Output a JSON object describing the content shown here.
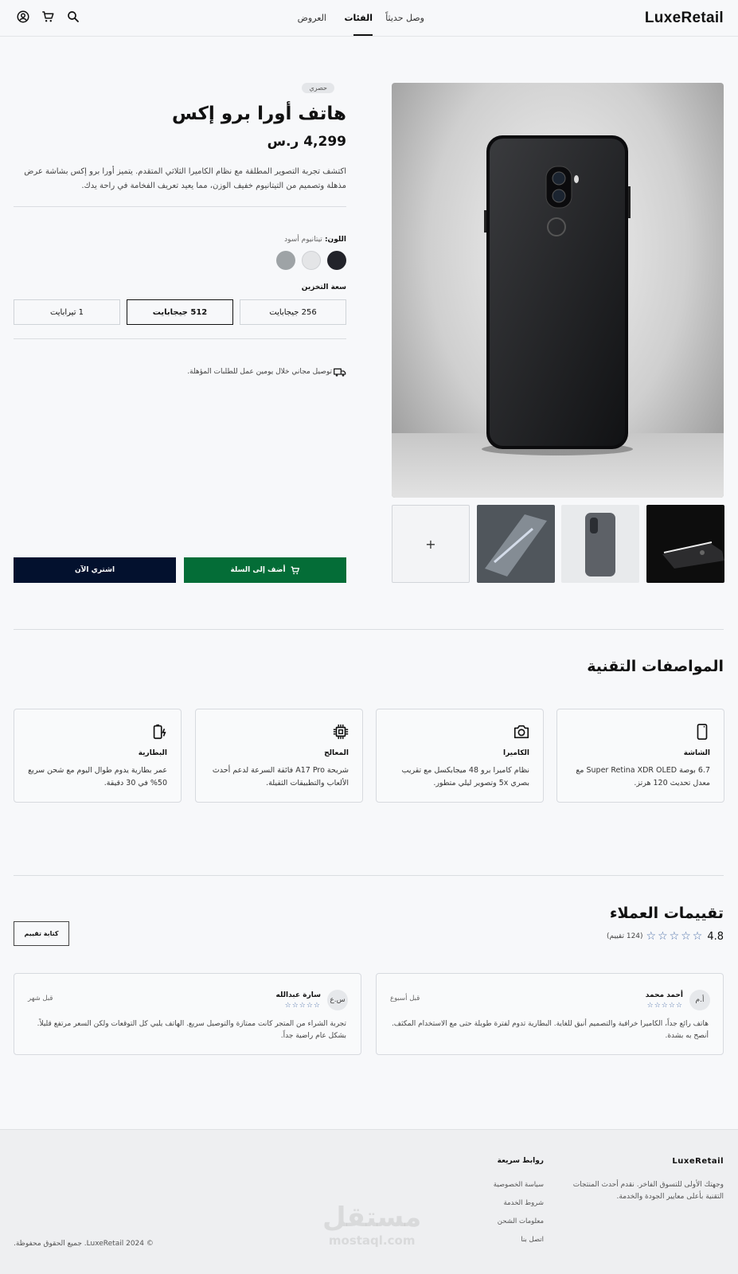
{
  "header": {
    "logo": "LuxeRetail",
    "nav": [
      {
        "label": "وصل حديثاً"
      },
      {
        "label": "الفئات"
      },
      {
        "label": "العروض"
      }
    ],
    "icons": [
      "search-icon",
      "cart-icon",
      "account-icon"
    ]
  },
  "product": {
    "badge": "حصري",
    "title": "هاتف أورا برو إكس",
    "price": "4,299 ر.س",
    "description": "اكتشف تجربة التصوير المطلقة مع نظام الكاميرا الثلاثي المتقدم. يتميز أورا برو إكس بشاشة عرض مذهلة وتصميم من التيتانيوم خفيف الوزن، مما يعيد تعريف الفخامة في راحة يدك.",
    "color_label": "اللون:",
    "color_value": "تيتانيوم أسود",
    "colors": [
      "#22232a",
      "#e4e5e7",
      "#9ea3a6"
    ],
    "storage_label": "سعة التخزين",
    "storage_options": [
      {
        "label": "256 جيجابايت",
        "selected": false
      },
      {
        "label": "512 جيجابايت",
        "selected": true
      },
      {
        "label": "1 تيرابايت",
        "selected": false
      }
    ],
    "shipping": "توصيل مجاني خلال يومين عمل للطلبات المؤهلة.",
    "add_to_cart": "أضف إلى السلة",
    "buy_now": "اشتري الآن",
    "add_thumb": "+",
    "colors_ui": {
      "cart_btn": "#046d37",
      "buy_btn": "#03112e"
    }
  },
  "specs": {
    "title": "المواصفات التقنية",
    "items": [
      {
        "icon": "phone-icon",
        "title": "الشاشة",
        "desc": "6.7 بوصة Super Retina XDR OLED مع معدل تحديث 120 هرتز."
      },
      {
        "icon": "camera-icon",
        "title": "الكاميرا",
        "desc": "نظام كاميرا برو 48 ميجابكسل مع تقريب بصري 5x وتصوير ليلي متطور."
      },
      {
        "icon": "chip-icon",
        "title": "المعالج",
        "desc": "شريحة A17 Pro فائقة السرعة لدعم أحدث الألعاب والتطبيقات الثقيلة."
      },
      {
        "icon": "battery-charging-icon",
        "title": "البطارية",
        "desc": "عمر بطارية يدوم طوال اليوم مع شحن سريع 50% في 30 دقيقة."
      }
    ]
  },
  "reviews": {
    "title": "تقييمات العملاء",
    "rating": "4.8",
    "count": "(124 تقييم)",
    "write_btn": "كتابة تقييم",
    "items": [
      {
        "initials": "أ.م",
        "name": "أحمد محمد",
        "stars": "☆☆☆☆☆",
        "date": "قبل أسبوع",
        "text": "هاتف رائع جداً، الكاميرا خرافية والتصميم أنيق للغاية. البطارية تدوم لفترة طويلة حتى مع الاستخدام المكثف. أنصح به بشدة."
      },
      {
        "initials": "س.ع",
        "name": "سارة عبدالله",
        "stars": "☆☆☆☆☆",
        "date": "قبل شهر",
        "text": "تجربة الشراء من المتجر كانت ممتازة والتوصيل سريع. الهاتف يلبي كل التوقعات ولكن السعر مرتفع قليلاً. بشكل عام راضية جداً."
      }
    ]
  },
  "footer": {
    "brand": "LuxeRetail",
    "about": "وجهتك الأولى للتسوق الفاخر. نقدم أحدث المنتجات التقنية بأعلى معايير الجودة والخدمة.",
    "links_title": "روابط سريعة",
    "links": [
      "سياسة الخصوصية",
      "شروط الخدمة",
      "معلومات الشحن",
      "اتصل بنا"
    ],
    "copyright": "© 2024 LuxeRetail. جميع الحقوق محفوظة.",
    "watermark_ar": "مستقل",
    "watermark_en": "mostaql.com"
  }
}
